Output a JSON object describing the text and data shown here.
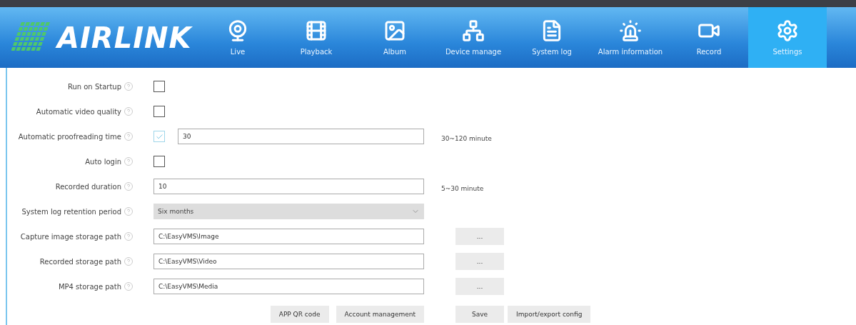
{
  "logo": {
    "text": "AIRLINK"
  },
  "nav": [
    {
      "label": "Live",
      "selected": false
    },
    {
      "label": "Playback",
      "selected": false
    },
    {
      "label": "Album",
      "selected": false
    },
    {
      "label": "Device manage",
      "selected": false
    },
    {
      "label": "System log",
      "selected": false
    },
    {
      "label": "Alarm information",
      "selected": false
    },
    {
      "label": "Record",
      "selected": false
    },
    {
      "label": "Settings",
      "selected": true
    }
  ],
  "settings": [
    {
      "kind": "checkbox",
      "label": "Run on Startup",
      "checked": false
    },
    {
      "kind": "checkbox",
      "label": "Automatic video quality",
      "checked": false
    },
    {
      "kind": "checkbox_input",
      "label": "Automatic proofreading time",
      "checked": true,
      "value": "30",
      "hint": "30~120 minute"
    },
    {
      "kind": "checkbox",
      "label": "Auto login",
      "checked": false
    },
    {
      "kind": "input",
      "label": "Recorded duration",
      "value": "10",
      "hint": "5~30 minute"
    },
    {
      "kind": "select",
      "label": "System log retention period",
      "value": "Six months"
    },
    {
      "kind": "path",
      "label": "Capture image storage path",
      "value": "C:\\EasyVMS\\Image",
      "button": "..."
    },
    {
      "kind": "path",
      "label": "Recorded storage path",
      "value": "C:\\EasyVMS\\Video",
      "button": "..."
    },
    {
      "kind": "path",
      "label": "MP4 storage path",
      "value": "C:\\EasyVMS\\Media",
      "button": "..."
    }
  ],
  "actions_left": [
    "APP QR code",
    "Account management"
  ],
  "actions_right": [
    "Save",
    "Import/export config"
  ]
}
